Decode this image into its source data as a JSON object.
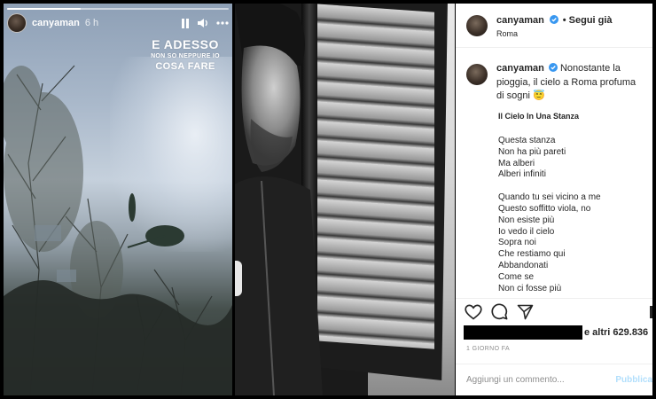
{
  "story": {
    "username": "canyaman",
    "time": "6 h",
    "progress_fraction": 0.33,
    "caption_line1": "E ADESSO",
    "caption_line2": "NON SO NEPPURE IO",
    "caption_line3": "COSA FARE",
    "icons": [
      "pause-icon",
      "speaker-icon",
      "more-icon"
    ]
  },
  "post": {
    "username": "canyaman",
    "follow_label": "Segui già",
    "location": "Roma",
    "caption_user": "canyaman",
    "caption_text": "Nonostante la pioggia, il cielo a Roma profuma di sogni 😇",
    "poem_title": "Il Cielo In Una Stanza",
    "stanza1": [
      "Questa stanza",
      "Non ha più pareti",
      "Ma alberi",
      "Alberi infiniti"
    ],
    "stanza2": [
      "Quando tu sei vicino a me",
      "Questo soffitto viola, no",
      "Non esiste più",
      "Io vedo il cielo",
      "Sopra noi",
      "Che restiamo qui",
      "Abbandonati",
      "Come se",
      "Non ci fosse più"
    ],
    "likes_text": "e altri 629.836",
    "time_ago": "1 GIORNO FA",
    "comment_placeholder": "Aggiungi un commento...",
    "publish_label": "Pubblica",
    "icons": [
      "heart-icon",
      "comment-icon",
      "share-icon",
      "verified-badge-icon"
    ],
    "colors": {
      "verified": "#3897f0",
      "publish": "#b2dffc",
      "text": "#262626",
      "muted": "#8e8e8e"
    }
  }
}
